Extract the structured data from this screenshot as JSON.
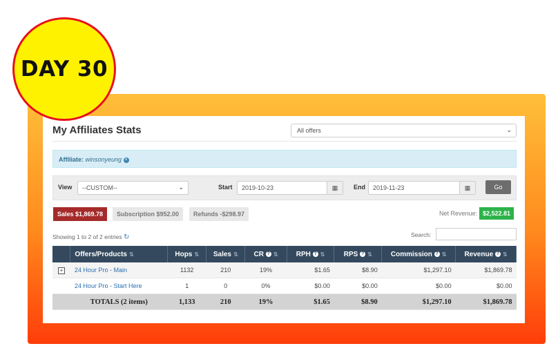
{
  "badge": {
    "text": "DAY 30"
  },
  "header": {
    "title": "My Affiliates Stats",
    "offers_select": "All offers"
  },
  "affiliate": {
    "label": "Affiliate:",
    "name": "winsonyeung"
  },
  "filter": {
    "view_label": "View",
    "view_value": "--CUSTOM--",
    "start_label": "Start",
    "start_value": "2019-10-23",
    "end_label": "End",
    "end_value": "2019-11-23",
    "go_label": "Go"
  },
  "summary": {
    "sales": "Sales $1,869.78",
    "subscription": "Subscription $952.00",
    "refunds": "Refunds -$298.97",
    "net_label": "Net Revenue:",
    "net_value": "$2,522.81"
  },
  "table_info": {
    "showing": "Showing 1 to 2 of 2 entries",
    "search_label": "Search:"
  },
  "table": {
    "columns": [
      "Offers/Products",
      "Hops",
      "Sales",
      "CR",
      "RPH",
      "RPS",
      "Commission",
      "Revenue"
    ],
    "rows": [
      {
        "offer": "24 Hour Pro - Main",
        "hops": "1132",
        "sales": "210",
        "cr": "19%",
        "rph": "$1.65",
        "rps": "$8.90",
        "commission": "$1,297.10",
        "revenue": "$1,869.78"
      },
      {
        "offer": "24 Hour Pro - Start Here",
        "hops": "1",
        "sales": "0",
        "cr": "0%",
        "rph": "$0.00",
        "rps": "$0.00",
        "commission": "$0.00",
        "revenue": "$0.00"
      }
    ],
    "totals": {
      "label": "TOTALS (2 items)",
      "hops": "1,133",
      "sales": "210",
      "cr": "19%",
      "rph": "$1.65",
      "rps": "$8.90",
      "commission": "$1,297.10",
      "revenue": "$1,869.78"
    }
  },
  "colors": {
    "frame": "#ff8a1d",
    "badge": "#fff200",
    "badge_border": "#e8101a",
    "header_bg": "#34495e",
    "sales_tag": "#a52a2a",
    "net_badge": "#2db34a"
  }
}
